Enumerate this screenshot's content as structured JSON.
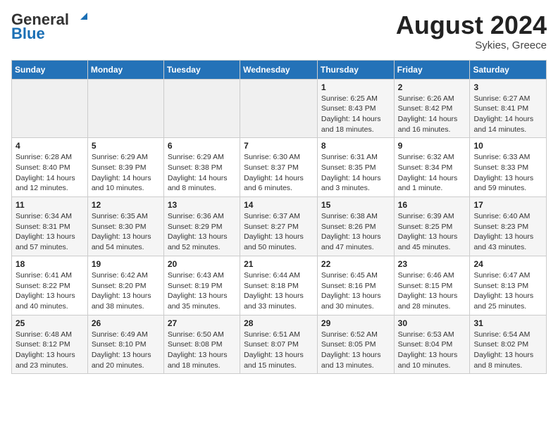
{
  "header": {
    "logo_general": "General",
    "logo_blue": "Blue",
    "month_year": "August 2024",
    "location": "Sykies, Greece"
  },
  "weekdays": [
    "Sunday",
    "Monday",
    "Tuesday",
    "Wednesday",
    "Thursday",
    "Friday",
    "Saturday"
  ],
  "weeks": [
    [
      {
        "day": "",
        "empty": true
      },
      {
        "day": "",
        "empty": true
      },
      {
        "day": "",
        "empty": true
      },
      {
        "day": "",
        "empty": true
      },
      {
        "day": "1",
        "line1": "Sunrise: 6:25 AM",
        "line2": "Sunset: 8:43 PM",
        "line3": "Daylight: 14 hours",
        "line4": "and 18 minutes."
      },
      {
        "day": "2",
        "line1": "Sunrise: 6:26 AM",
        "line2": "Sunset: 8:42 PM",
        "line3": "Daylight: 14 hours",
        "line4": "and 16 minutes."
      },
      {
        "day": "3",
        "line1": "Sunrise: 6:27 AM",
        "line2": "Sunset: 8:41 PM",
        "line3": "Daylight: 14 hours",
        "line4": "and 14 minutes."
      }
    ],
    [
      {
        "day": "4",
        "line1": "Sunrise: 6:28 AM",
        "line2": "Sunset: 8:40 PM",
        "line3": "Daylight: 14 hours",
        "line4": "and 12 minutes."
      },
      {
        "day": "5",
        "line1": "Sunrise: 6:29 AM",
        "line2": "Sunset: 8:39 PM",
        "line3": "Daylight: 14 hours",
        "line4": "and 10 minutes."
      },
      {
        "day": "6",
        "line1": "Sunrise: 6:29 AM",
        "line2": "Sunset: 8:38 PM",
        "line3": "Daylight: 14 hours",
        "line4": "and 8 minutes."
      },
      {
        "day": "7",
        "line1": "Sunrise: 6:30 AM",
        "line2": "Sunset: 8:37 PM",
        "line3": "Daylight: 14 hours",
        "line4": "and 6 minutes."
      },
      {
        "day": "8",
        "line1": "Sunrise: 6:31 AM",
        "line2": "Sunset: 8:35 PM",
        "line3": "Daylight: 14 hours",
        "line4": "and 3 minutes."
      },
      {
        "day": "9",
        "line1": "Sunrise: 6:32 AM",
        "line2": "Sunset: 8:34 PM",
        "line3": "Daylight: 14 hours",
        "line4": "and 1 minute."
      },
      {
        "day": "10",
        "line1": "Sunrise: 6:33 AM",
        "line2": "Sunset: 8:33 PM",
        "line3": "Daylight: 13 hours",
        "line4": "and 59 minutes."
      }
    ],
    [
      {
        "day": "11",
        "line1": "Sunrise: 6:34 AM",
        "line2": "Sunset: 8:31 PM",
        "line3": "Daylight: 13 hours",
        "line4": "and 57 minutes."
      },
      {
        "day": "12",
        "line1": "Sunrise: 6:35 AM",
        "line2": "Sunset: 8:30 PM",
        "line3": "Daylight: 13 hours",
        "line4": "and 54 minutes."
      },
      {
        "day": "13",
        "line1": "Sunrise: 6:36 AM",
        "line2": "Sunset: 8:29 PM",
        "line3": "Daylight: 13 hours",
        "line4": "and 52 minutes."
      },
      {
        "day": "14",
        "line1": "Sunrise: 6:37 AM",
        "line2": "Sunset: 8:27 PM",
        "line3": "Daylight: 13 hours",
        "line4": "and 50 minutes."
      },
      {
        "day": "15",
        "line1": "Sunrise: 6:38 AM",
        "line2": "Sunset: 8:26 PM",
        "line3": "Daylight: 13 hours",
        "line4": "and 47 minutes."
      },
      {
        "day": "16",
        "line1": "Sunrise: 6:39 AM",
        "line2": "Sunset: 8:25 PM",
        "line3": "Daylight: 13 hours",
        "line4": "and 45 minutes."
      },
      {
        "day": "17",
        "line1": "Sunrise: 6:40 AM",
        "line2": "Sunset: 8:23 PM",
        "line3": "Daylight: 13 hours",
        "line4": "and 43 minutes."
      }
    ],
    [
      {
        "day": "18",
        "line1": "Sunrise: 6:41 AM",
        "line2": "Sunset: 8:22 PM",
        "line3": "Daylight: 13 hours",
        "line4": "and 40 minutes."
      },
      {
        "day": "19",
        "line1": "Sunrise: 6:42 AM",
        "line2": "Sunset: 8:20 PM",
        "line3": "Daylight: 13 hours",
        "line4": "and 38 minutes."
      },
      {
        "day": "20",
        "line1": "Sunrise: 6:43 AM",
        "line2": "Sunset: 8:19 PM",
        "line3": "Daylight: 13 hours",
        "line4": "and 35 minutes."
      },
      {
        "day": "21",
        "line1": "Sunrise: 6:44 AM",
        "line2": "Sunset: 8:18 PM",
        "line3": "Daylight: 13 hours",
        "line4": "and 33 minutes."
      },
      {
        "day": "22",
        "line1": "Sunrise: 6:45 AM",
        "line2": "Sunset: 8:16 PM",
        "line3": "Daylight: 13 hours",
        "line4": "and 30 minutes."
      },
      {
        "day": "23",
        "line1": "Sunrise: 6:46 AM",
        "line2": "Sunset: 8:15 PM",
        "line3": "Daylight: 13 hours",
        "line4": "and 28 minutes."
      },
      {
        "day": "24",
        "line1": "Sunrise: 6:47 AM",
        "line2": "Sunset: 8:13 PM",
        "line3": "Daylight: 13 hours",
        "line4": "and 25 minutes."
      }
    ],
    [
      {
        "day": "25",
        "line1": "Sunrise: 6:48 AM",
        "line2": "Sunset: 8:12 PM",
        "line3": "Daylight: 13 hours",
        "line4": "and 23 minutes."
      },
      {
        "day": "26",
        "line1": "Sunrise: 6:49 AM",
        "line2": "Sunset: 8:10 PM",
        "line3": "Daylight: 13 hours",
        "line4": "and 20 minutes."
      },
      {
        "day": "27",
        "line1": "Sunrise: 6:50 AM",
        "line2": "Sunset: 8:08 PM",
        "line3": "Daylight: 13 hours",
        "line4": "and 18 minutes."
      },
      {
        "day": "28",
        "line1": "Sunrise: 6:51 AM",
        "line2": "Sunset: 8:07 PM",
        "line3": "Daylight: 13 hours",
        "line4": "and 15 minutes."
      },
      {
        "day": "29",
        "line1": "Sunrise: 6:52 AM",
        "line2": "Sunset: 8:05 PM",
        "line3": "Daylight: 13 hours",
        "line4": "and 13 minutes."
      },
      {
        "day": "30",
        "line1": "Sunrise: 6:53 AM",
        "line2": "Sunset: 8:04 PM",
        "line3": "Daylight: 13 hours",
        "line4": "and 10 minutes."
      },
      {
        "day": "31",
        "line1": "Sunrise: 6:54 AM",
        "line2": "Sunset: 8:02 PM",
        "line3": "Daylight: 13 hours",
        "line4": "and 8 minutes."
      }
    ]
  ]
}
